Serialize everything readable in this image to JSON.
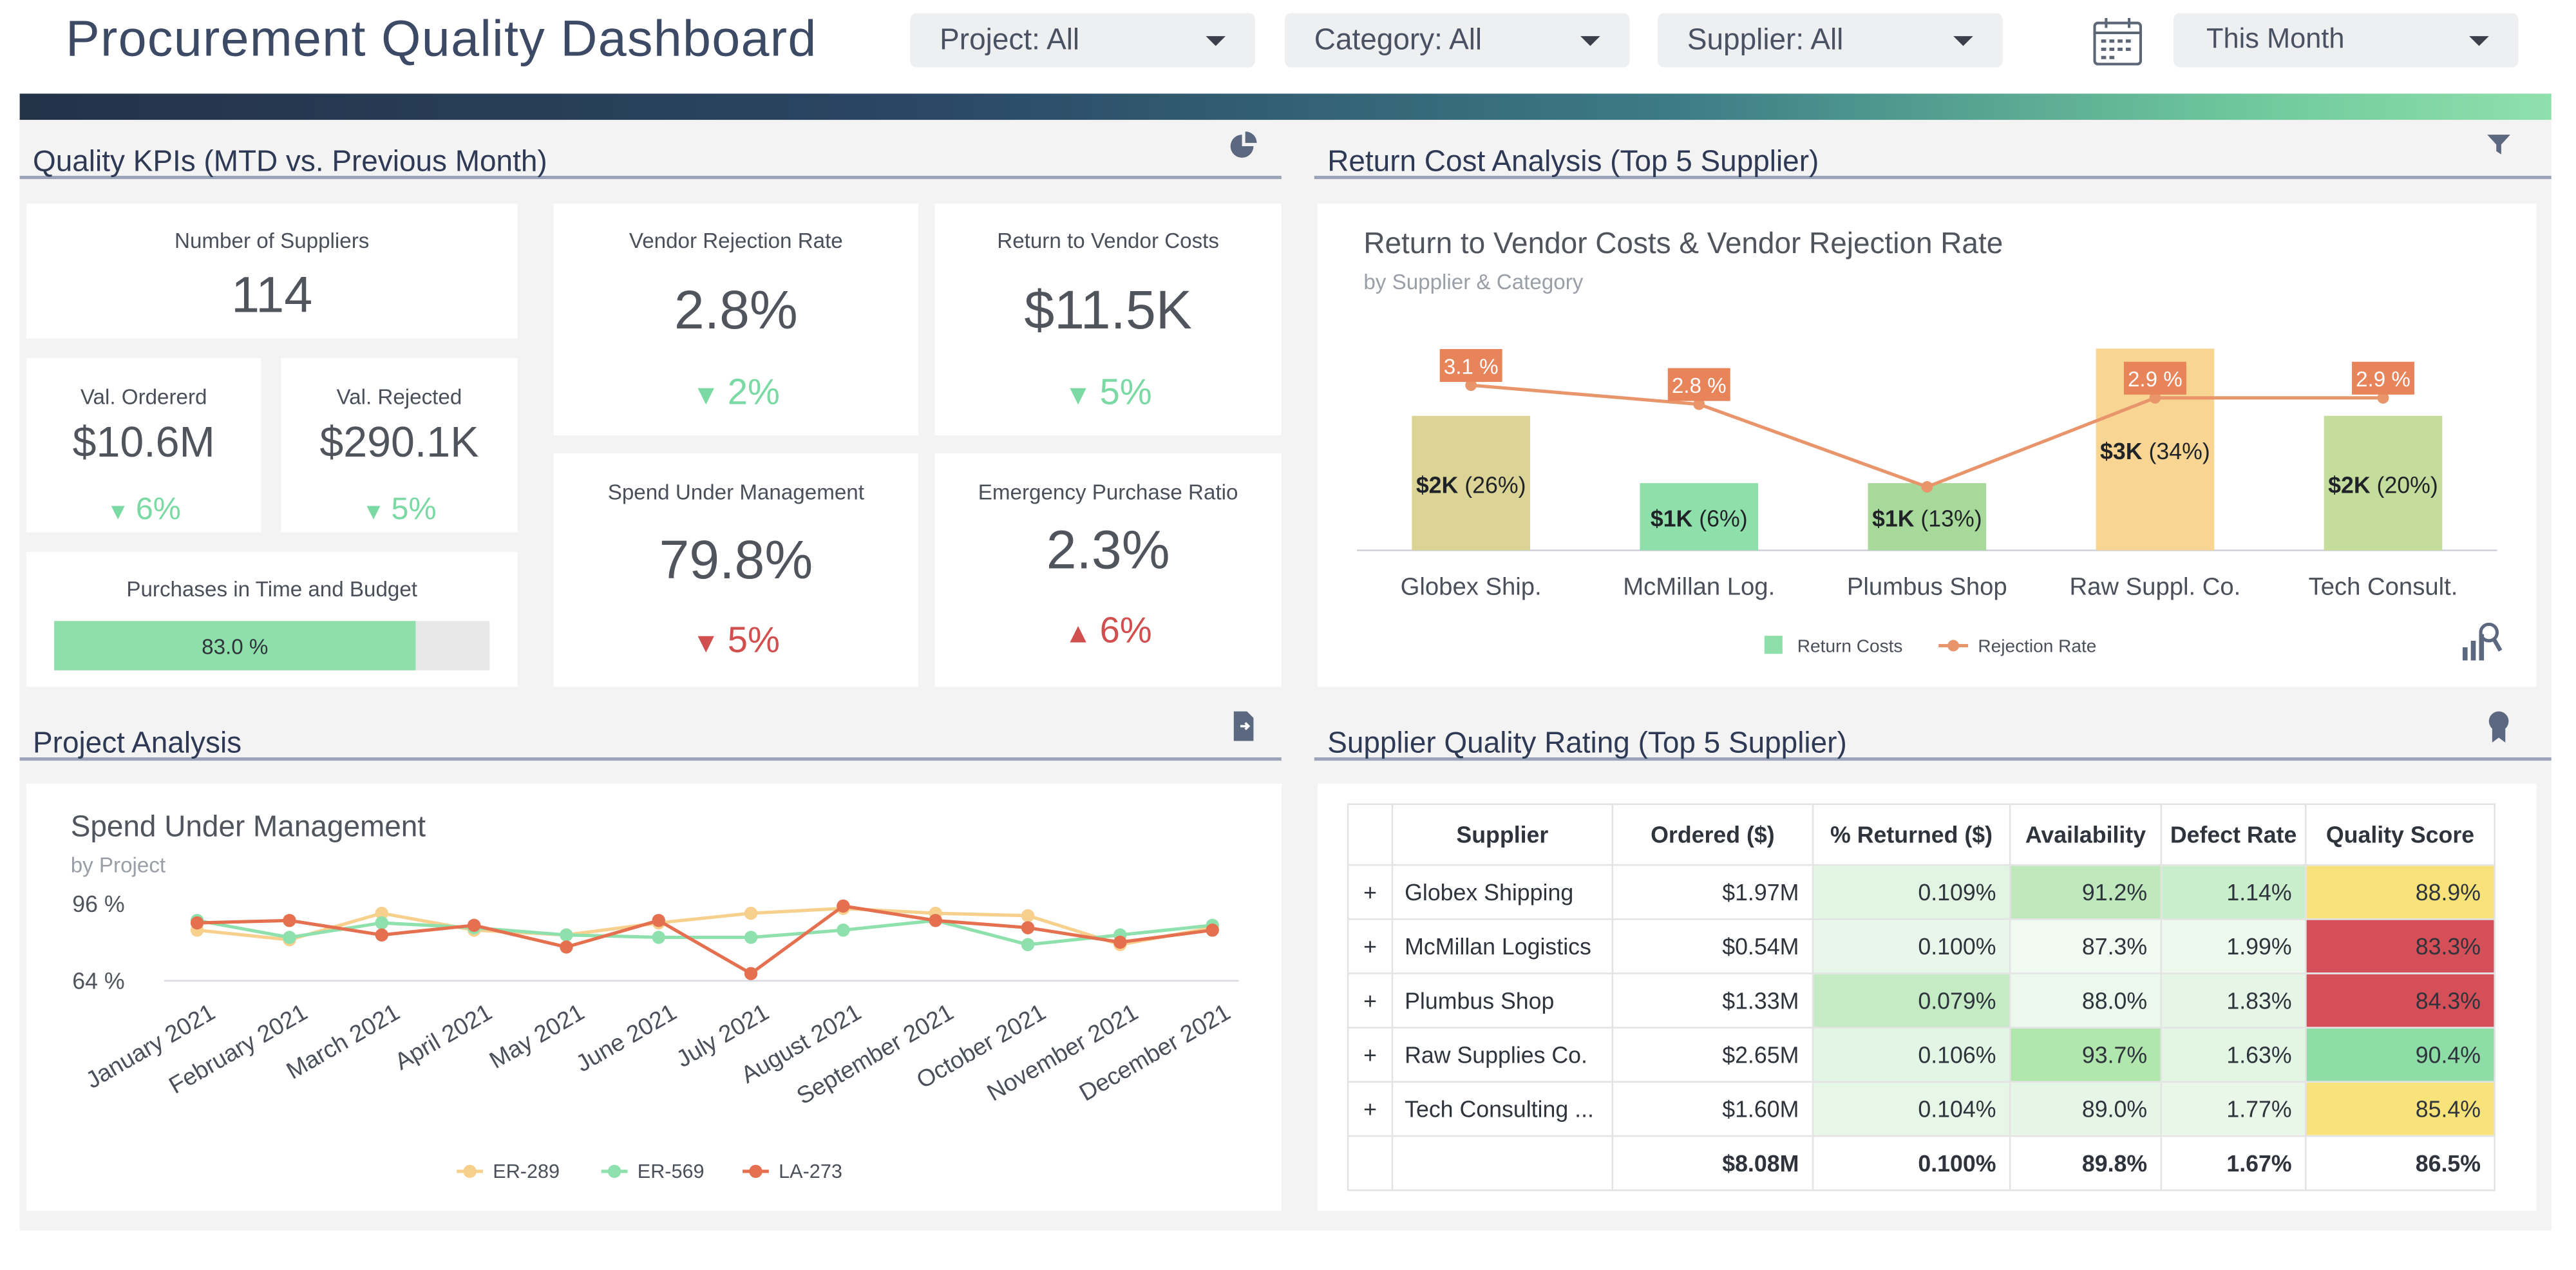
{
  "header": {
    "title": "Procurement Quality Dashboard",
    "filters": [
      "Project: All",
      "Category: All",
      "Supplier: All"
    ],
    "period": "This Month",
    "calendar_icon": "calendar-icon"
  },
  "kpi": {
    "section_title": "Quality KPIs (MTD vs. Previous Month)",
    "icon": "pie-chart-icon",
    "suppliers": {
      "label": "Number of Suppliers",
      "value": "114"
    },
    "ordered": {
      "label": "Val. Ordererd",
      "value": "$10.6M",
      "delta": "6%",
      "dir": "down"
    },
    "rejected": {
      "label": "Val. Rejected",
      "value": "$290.1K",
      "delta": "5%",
      "dir": "down"
    },
    "purchases": {
      "label": "Purchases in Time and Budget",
      "value": "83.0 %",
      "fraction": 0.83
    },
    "vrr": {
      "label": "Vendor Rejection Rate",
      "value": "2.8%",
      "delta": "2%",
      "dir": "down"
    },
    "rtv": {
      "label": "Return to Vendor Costs",
      "value": "$11.5K",
      "delta": "5%",
      "dir": "down"
    },
    "sum": {
      "label": "Spend Under Management",
      "value": "79.8%",
      "delta": "5%",
      "dir": "down"
    },
    "epr": {
      "label": "Emergency Purchase Ratio",
      "value": "2.3%",
      "delta": "6%",
      "dir": "up"
    }
  },
  "colors": {
    "down": "#7bd9a4",
    "up": "#d24f4f",
    "bar_fill": "#8fdfaa"
  },
  "return_cost": {
    "section_title": "Return Cost Analysis (Top 5 Supplier)",
    "icon": "filter-icon",
    "chart_icon": "chart-settings-icon",
    "chart_data": {
      "type": "bar",
      "title": "Return to Vendor Costs & Vendor Rejection Rate",
      "subtitle": "by Supplier & Category",
      "categories": [
        "Globex Ship.",
        "McMillan Log.",
        "Plumbus Shop",
        "Raw Suppl. Co.",
        "Tech Consult."
      ],
      "series": [
        {
          "name": "Return Costs",
          "type": "bar",
          "values": [
            2,
            1,
            1,
            3,
            2
          ],
          "value_labels": [
            "$2K",
            "$1K",
            "$1K",
            "$3K",
            "$2K"
          ],
          "share_labels": [
            "(26%)",
            "(6%)",
            "(13%)",
            "(34%)",
            "(20%)"
          ],
          "colors": [
            "#dcd497",
            "#8fdfaa",
            "#a7d99a",
            "#f8d593",
            "#c5dd9c"
          ]
        },
        {
          "name": "Rejection Rate",
          "type": "line",
          "values": [
            3.1,
            2.8,
            1.5,
            2.9,
            2.9
          ],
          "point_labels": [
            "3.1 %",
            "2.8 %",
            "",
            "2.9 %",
            "2.9 %"
          ],
          "color": "#e8956c"
        }
      ]
    }
  },
  "project": {
    "section_title": "Project Analysis",
    "icon": "export-icon",
    "chart_data": {
      "type": "line",
      "title": "Spend Under Management",
      "subtitle": "by Project",
      "y_ticks": [
        "96 %",
        "64 %"
      ],
      "categories": [
        "January 2021",
        "February 2021",
        "March 2021",
        "April 2021",
        "May 2021",
        "June 2021",
        "July 2021",
        "August 2021",
        "September 2021",
        "October 2021",
        "November 2021",
        "December 2021"
      ],
      "series": [
        {
          "name": "ER-289",
          "color": "#f7d08e",
          "values": [
            85,
            81,
            92,
            85,
            83,
            88,
            92,
            94,
            92,
            91,
            79,
            86
          ]
        },
        {
          "name": "ER-569",
          "color": "#8ee0ac",
          "values": [
            89,
            82,
            88,
            86,
            83,
            82,
            82,
            85,
            89,
            79,
            83,
            87
          ]
        },
        {
          "name": "LA-273",
          "color": "#e5704f",
          "values": [
            88,
            89,
            83,
            87,
            78,
            89,
            67,
            95,
            89,
            86,
            80,
            85
          ]
        }
      ]
    }
  },
  "supplier": {
    "section_title": "Supplier Quality Rating (Top 5 Supplier)",
    "icon": "award-icon",
    "columns": [
      "Supplier",
      "Ordered ($)",
      "% Returned ($)",
      "Availability",
      "Defect Rate",
      "Quality Score"
    ],
    "rows": [
      {
        "name": "Globex Shipping",
        "ordered": "$1.97M",
        "returned": "0.109%",
        "availability": "91.2%",
        "defect": "1.14%",
        "quality": "88.9%",
        "c": [
          "#e2f5e3",
          "#bfe9bd",
          "#c9eecb",
          "#f7e37a"
        ]
      },
      {
        "name": "McMillan Logistics",
        "ordered": "$0.54M",
        "returned": "0.100%",
        "availability": "87.3%",
        "defect": "1.99%",
        "quality": "83.3%",
        "c": [
          "#e9f7ea",
          "#f0faf0",
          "#eef9ee",
          "#d44f57"
        ]
      },
      {
        "name": "Plumbus Shop",
        "ordered": "$1.33M",
        "returned": "0.079%",
        "availability": "88.0%",
        "defect": "1.83%",
        "quality": "84.3%",
        "c": [
          "#c4ebc4",
          "#ecf8ec",
          "#e6f6e6",
          "#d44f57"
        ]
      },
      {
        "name": "Raw Supplies Co.",
        "ordered": "$2.65M",
        "returned": "0.106%",
        "availability": "93.7%",
        "defect": "1.63%",
        "quality": "90.4%",
        "c": [
          "#e3f5e4",
          "#b1e6ad",
          "#e3f5e3",
          "#8edca6"
        ]
      },
      {
        "name": "Tech Consulting ...",
        "ordered": "$1.60M",
        "returned": "0.104%",
        "availability": "89.0%",
        "defect": "1.77%",
        "quality": "85.4%",
        "c": [
          "#e6f6e7",
          "#e6f6e6",
          "#e8f7e8",
          "#f7e37a"
        ]
      }
    ],
    "expand": "+",
    "totals": {
      "ordered": "$8.08M",
      "returned": "0.100%",
      "availability": "89.8%",
      "defect": "1.67%",
      "quality": "86.5%"
    }
  }
}
